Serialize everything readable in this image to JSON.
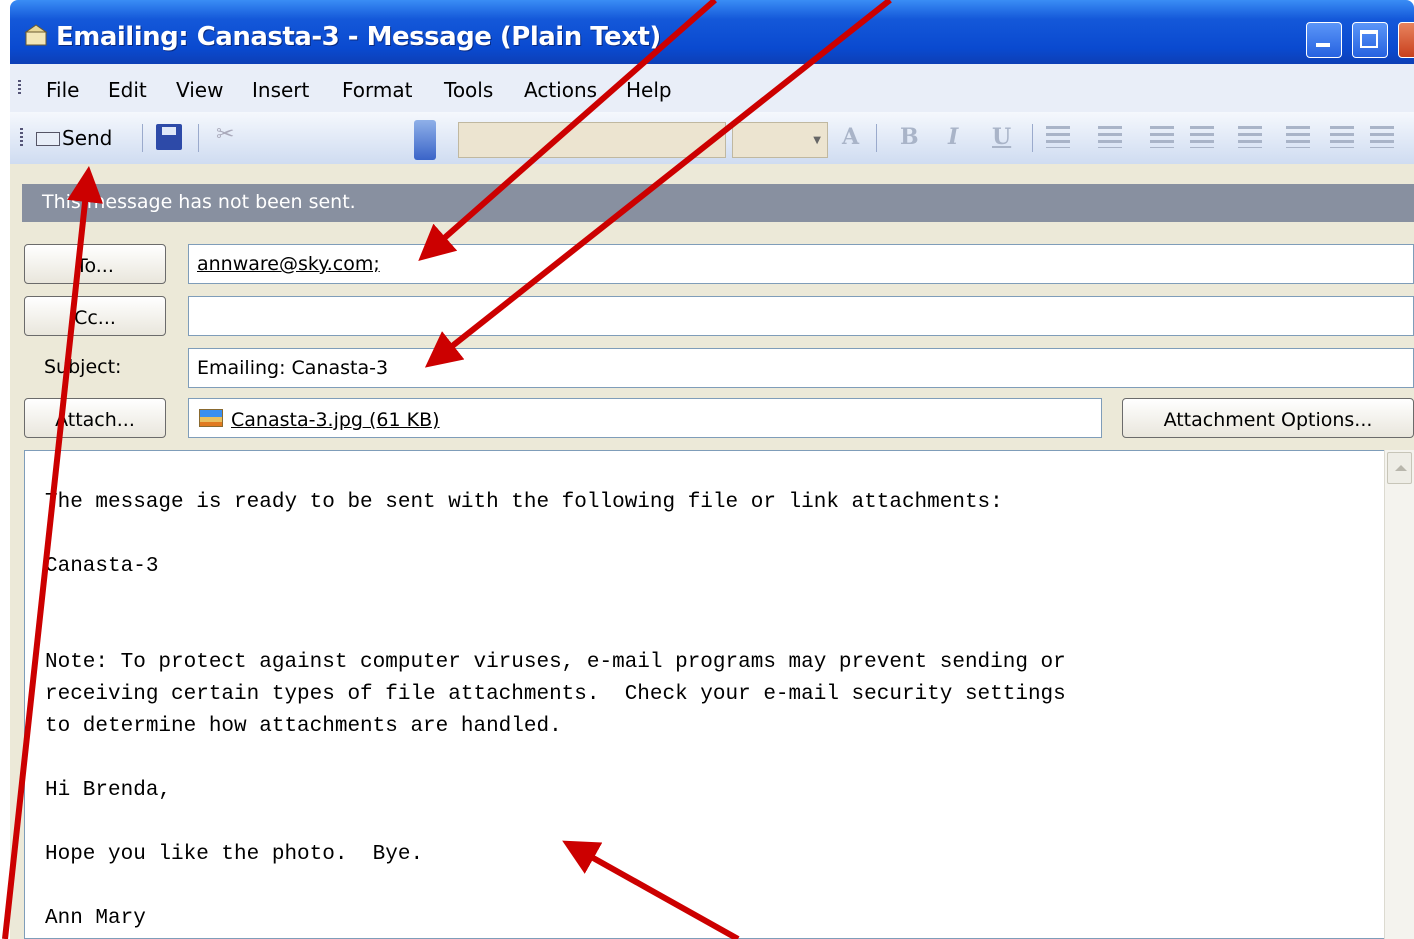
{
  "window": {
    "title": "Emailing: Canasta-3 - Message (Plain Text)"
  },
  "menu": [
    "File",
    "Edit",
    "View",
    "Insert",
    "Format",
    "Tools",
    "Actions",
    "Help"
  ],
  "toolbar": {
    "send_label": "Send"
  },
  "infobar": {
    "text": "This message has not been sent."
  },
  "header": {
    "to_label": "To...",
    "to_value": "annware@sky.com;",
    "cc_label": "Cc...",
    "cc_value": "",
    "subject_label": "Subject:",
    "subject_value": "Emailing: Canasta-3",
    "attach_label": "Attach...",
    "attachment_name": "Canasta-3.jpg (61 KB)",
    "attach_options_label": "Attachment Options..."
  },
  "body": {
    "text": "The message is ready to be sent with the following file or link attachments:\n\nCanasta-3\n\n\nNote: To protect against computer viruses, e-mail programs may prevent sending or\nreceiving certain types of file attachments.  Check your e-mail security settings\nto determine how attachments are handled.\n\nHi Brenda,\n\nHope you like the photo.  Bye.\n\nAnn Mary"
  },
  "colors": {
    "titlebar": "#0a4ad0",
    "annotation_arrow": "#cc0000"
  }
}
